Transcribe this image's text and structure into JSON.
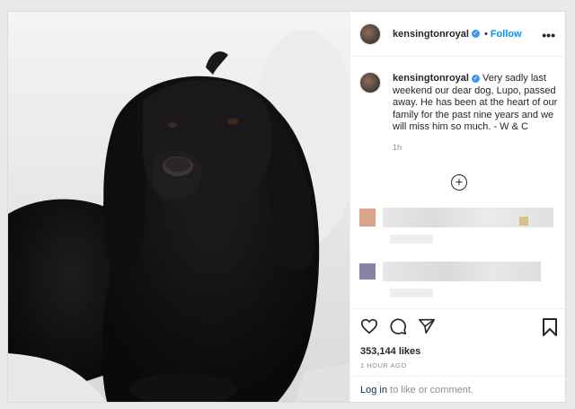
{
  "post": {
    "username": "kensingtonroyal",
    "verified_mark": "✓",
    "dot": "•",
    "follow_label": "Follow",
    "more_label": "•••",
    "caption_text": "Very sadly last weekend our dear dog, Lupo, passed away. He has been at the heart of our family for the past nine years and we will miss him so much. - W & C",
    "caption_time": "1h",
    "load_more_label": "+",
    "likes": "353,144 likes",
    "posted_ago": "1 HOUR AGO",
    "login_link": "Log in",
    "login_rest": " to like or comment."
  },
  "icons": [
    "heart-icon",
    "comment-icon",
    "share-icon",
    "bookmark-icon",
    "more-options-icon",
    "verified-badge-icon",
    "add-comment-icon"
  ],
  "colors": {
    "link_blue": "#0095f6",
    "text": "#262626",
    "muted": "#8e8e8e",
    "verified": "#3897f0"
  }
}
